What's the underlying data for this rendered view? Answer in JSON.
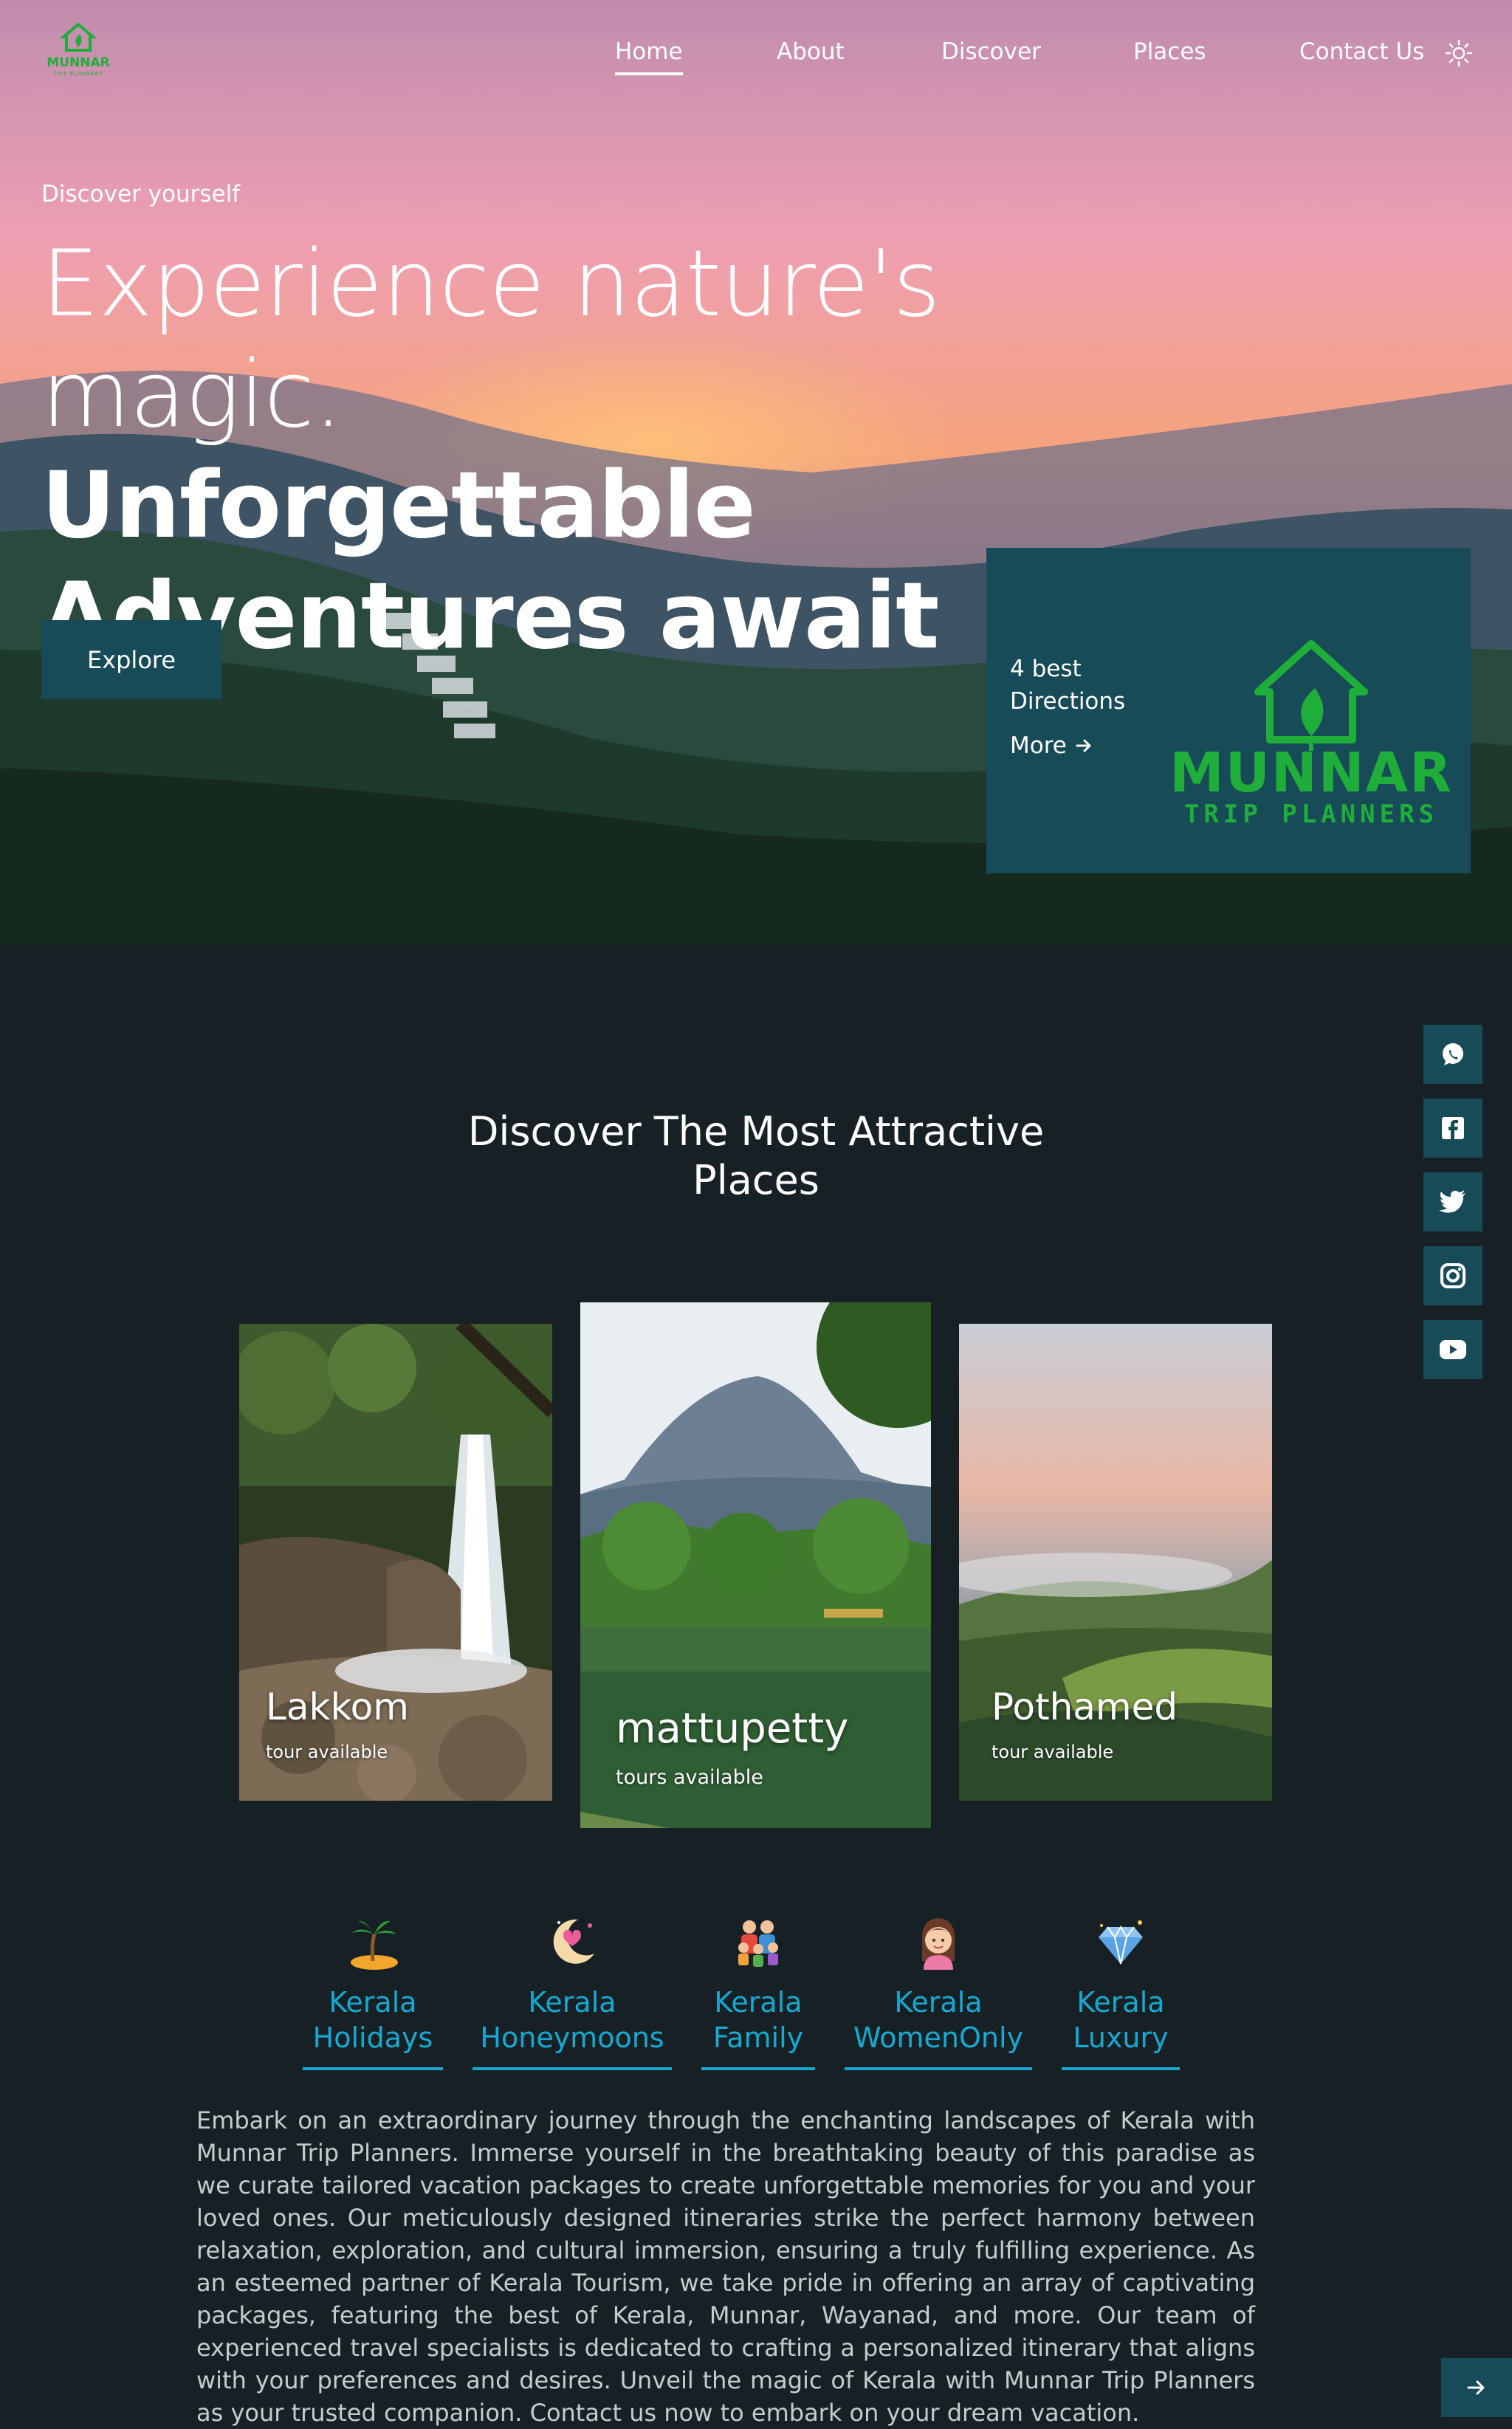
{
  "nav": {
    "links": [
      "Home",
      "About",
      "Discover",
      "Places",
      "Contact Us"
    ],
    "active": "Home",
    "theme_icon": "sun-icon",
    "logo_text": "MUNNAR",
    "logo_subtext": "TRIP PLANNERS"
  },
  "hero": {
    "eyebrow": "Discover yourself",
    "headline_line1": "Experience nature's",
    "headline_line2_thin": "magic.",
    "headline_line2_bold": "Unforgettable",
    "headline_line3": "Adventures await",
    "explore_label": "Explore"
  },
  "promo": {
    "text": "4 best Directions",
    "more_label": "More",
    "logo_main": "MUNNAR",
    "logo_sub": "TRIP PLANNERS",
    "brand_green": "#1fae3a"
  },
  "social": [
    "whatsapp-icon",
    "facebook-icon",
    "twitter-icon",
    "instagram-icon",
    "youtube-icon"
  ],
  "section": {
    "title": "Discover The Most Attractive Places"
  },
  "places": [
    {
      "name": "Lakkom",
      "sub": "tour available"
    },
    {
      "name": "mattupetty",
      "sub": "tours available"
    },
    {
      "name": "Pothamed",
      "sub": "tour available"
    }
  ],
  "categories": [
    {
      "icon": "palm-island-icon",
      "line1": "Kerala",
      "line2": "Holidays"
    },
    {
      "icon": "moon-heart-icon",
      "line1": "Kerala",
      "line2": "Honeymoons"
    },
    {
      "icon": "family-icon",
      "line1": "Kerala",
      "line2": "Family"
    },
    {
      "icon": "woman-icon",
      "line1": "Kerala",
      "line2": "WomenOnly"
    },
    {
      "icon": "diamond-icon",
      "line1": "Kerala",
      "line2": "Luxury"
    }
  ],
  "body_text": "Embark on an extraordinary journey through the enchanting landscapes of Kerala with Munnar Trip Planners. Immerse yourself in the breathtaking beauty of this paradise as we curate tailored vacation packages to create unforgettable memories for you and your loved ones. Our meticulously designed itineraries strike the perfect harmony between relaxation, exploration, and cultural immersion, ensuring a truly fulfilling experience. As an esteemed partner of Kerala Tourism, we take pride in offering an array of captivating packages, featuring the best of Kerala, Munnar, Wayanad, and more. Our team of experienced travel specialists is dedicated to crafting a personalized itinerary that aligns with your preferences and desires. Unveil the magic of Kerala with Munnar Trip Planners as your trusted companion. Contact us now to embark on your dream vacation.",
  "colors": {
    "accent": "#174b58",
    "link_blue": "#17a9d1",
    "background": "#172125"
  }
}
